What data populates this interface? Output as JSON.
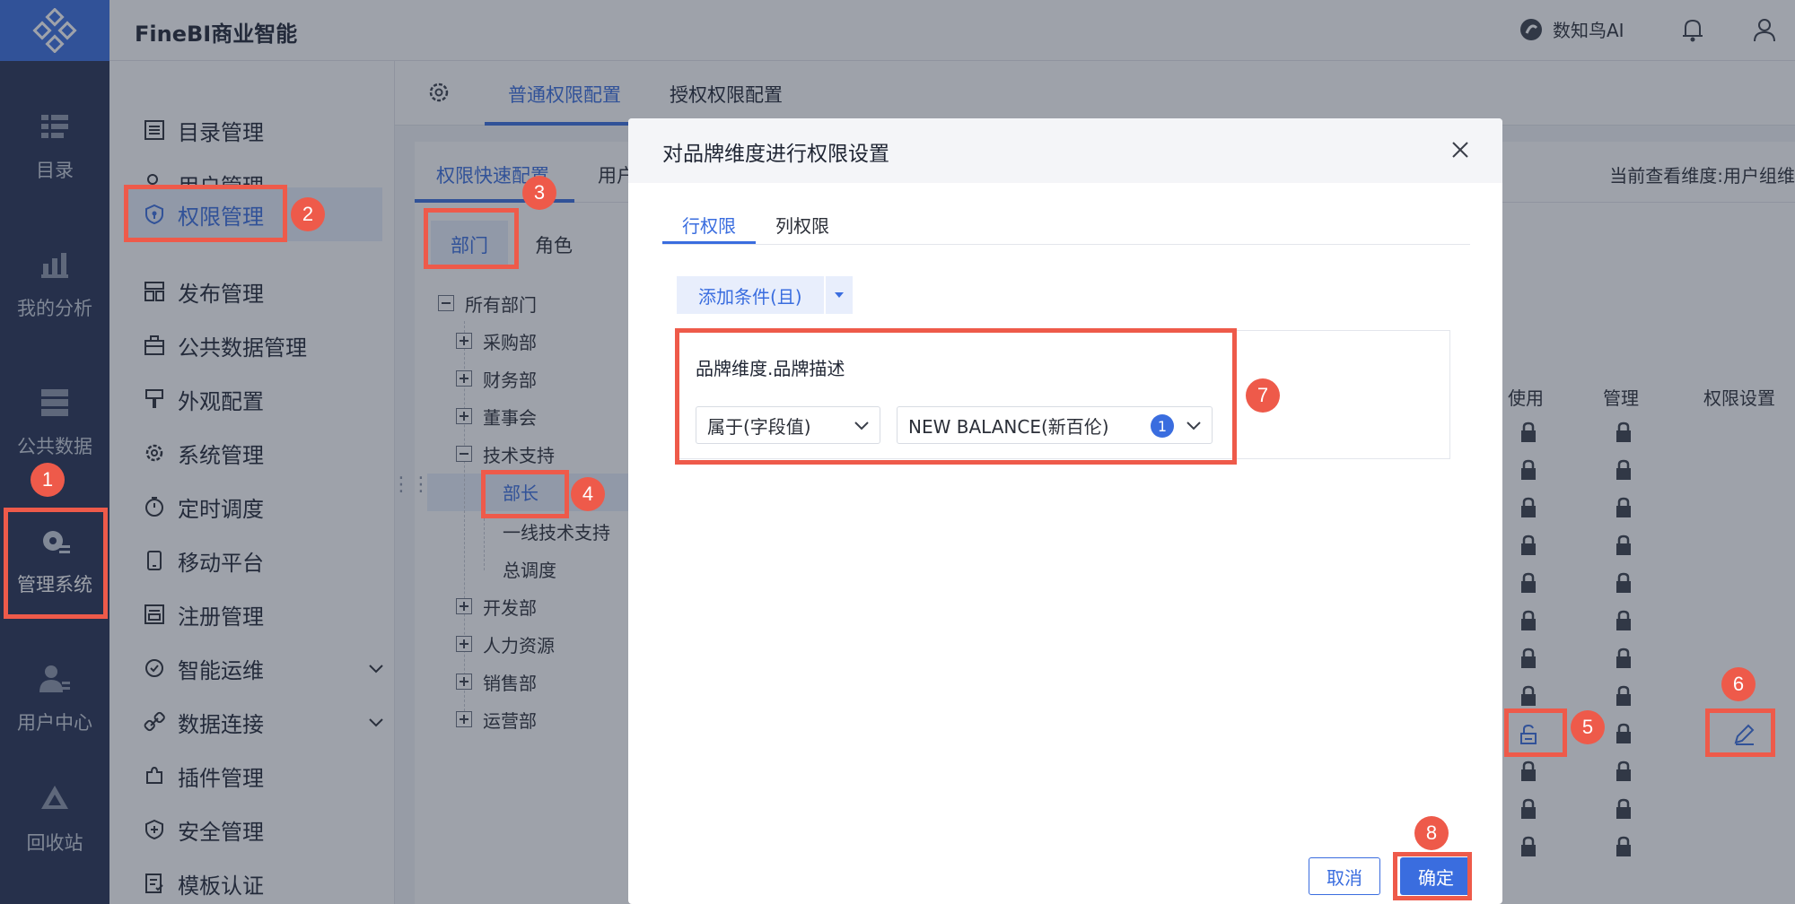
{
  "app": {
    "title": "FineBI商业智能"
  },
  "topbar": {
    "ai_label": "数知鸟AI"
  },
  "rail": [
    {
      "label": "目录"
    },
    {
      "label": "我的分析"
    },
    {
      "label": "公共数据"
    },
    {
      "label": "管理系统"
    },
    {
      "label": "用户中心"
    },
    {
      "label": "回收站"
    }
  ],
  "menu": [
    {
      "label": "目录管理"
    },
    {
      "label": "用户管理"
    },
    {
      "label": "权限管理"
    },
    {
      "label": "发布管理"
    },
    {
      "label": "公共数据管理"
    },
    {
      "label": "外观配置"
    },
    {
      "label": "系统管理"
    },
    {
      "label": "定时调度"
    },
    {
      "label": "移动平台"
    },
    {
      "label": "注册管理"
    },
    {
      "label": "智能运维"
    },
    {
      "label": "数据连接"
    },
    {
      "label": "插件管理"
    },
    {
      "label": "安全管理"
    },
    {
      "label": "模板认证"
    }
  ],
  "tabs": {
    "normal": "普通权限配置",
    "grant": "授权权限配置"
  },
  "subtabs": {
    "quick": "权限快速配置",
    "user": "用户",
    "view_dim": "当前查看维度:用户组维"
  },
  "dept_tabs": {
    "dept": "部门",
    "role": "角色"
  },
  "tree": [
    {
      "label": "所有部门"
    },
    {
      "label": "采购部"
    },
    {
      "label": "财务部"
    },
    {
      "label": "董事会"
    },
    {
      "label": "技术支持"
    },
    {
      "label": "部长"
    },
    {
      "label": "一线技术支持"
    },
    {
      "label": "总调度"
    },
    {
      "label": "开发部"
    },
    {
      "label": "人力资源"
    },
    {
      "label": "销售部"
    },
    {
      "label": "运营部"
    }
  ],
  "columns": {
    "use": "使用",
    "manage": "管理",
    "settings": "权限设置"
  },
  "modal": {
    "title": "对品牌维度进行权限设置",
    "tabs": {
      "row": "行权限",
      "col": "列权限"
    },
    "add_condition": "添加条件(且)",
    "field": "品牌维度.品牌描述",
    "operator": "属于(字段值)",
    "value": "NEW BALANCE(新百伦)",
    "value_count": "1",
    "cancel": "取消",
    "ok": "确定"
  },
  "markers": [
    "1",
    "2",
    "3",
    "4",
    "5",
    "6",
    "7",
    "8"
  ]
}
